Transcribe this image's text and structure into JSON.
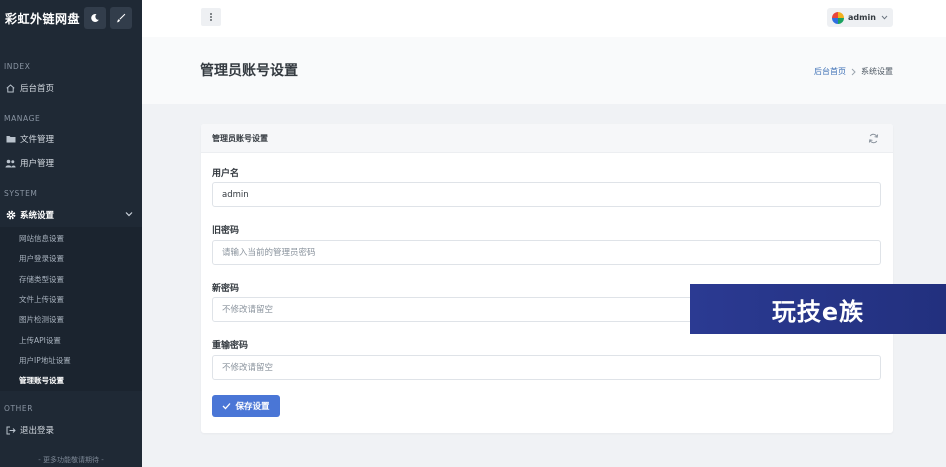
{
  "brand": {
    "title": "彩虹外链网盘",
    "accent": "#4a76d6"
  },
  "sidebar": {
    "section_index": "INDEX",
    "section_manage": "MANAGE",
    "section_system": "SYSTEM",
    "section_other": "OTHER",
    "item_home": "后台首页",
    "item_files": "文件管理",
    "item_users": "用户管理",
    "item_settings": "系统设置",
    "submenu": [
      "网站信息设置",
      "用户登录设置",
      "存储类型设置",
      "文件上传设置",
      "图片检测设置",
      "上传API设置",
      "用户IP地址设置",
      "管理账号设置"
    ],
    "item_logout": "退出登录",
    "footer": "- 更多功能敬请期待 -"
  },
  "topbar": {
    "user_name": "admin"
  },
  "page": {
    "title": "管理员账号设置",
    "breadcrumb_home": "后台首页",
    "breadcrumb_current": "系统设置"
  },
  "card": {
    "title": "管理员账号设置",
    "username_label": "用户名",
    "username_value": "admin",
    "old_password_label": "旧密码",
    "old_password_placeholder": "请输入当前的管理员密码",
    "new_password_label": "新密码",
    "new_password_placeholder": "不修改请留空",
    "confirm_password_label": "重输密码",
    "confirm_password_placeholder": "不修改请留空",
    "save_label": "保存设置"
  },
  "watermark": {
    "text": "玩技e族"
  }
}
